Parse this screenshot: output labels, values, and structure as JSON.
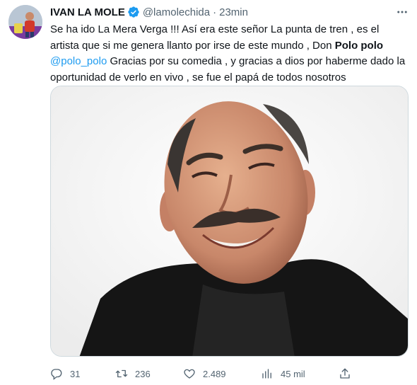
{
  "author": {
    "display_name": "IVAN LA MOLE",
    "handle": "@lamolechida",
    "separator": "·",
    "time": "23min"
  },
  "tweet": {
    "text_part1": "Se ha ido La Mera Verga !!! Así era este señor La punta de tren , es el artista que si me genera llanto por irse de este mundo , Don ",
    "bold_name": "Polo polo",
    "mention": "@polo_polo",
    "text_part2": " Gracias por su comedia , y gracias a dios por haberme dado la oportunidad de verlo en vivo , se fue el papá de todos nosotros"
  },
  "actions": {
    "reply_count": "31",
    "retweet_count": "236",
    "like_count": "2.489",
    "views_count": "45 mil"
  },
  "colors": {
    "accent": "#1d9bf0",
    "secondary_text": "#536471",
    "primary_text": "#0f1419"
  }
}
